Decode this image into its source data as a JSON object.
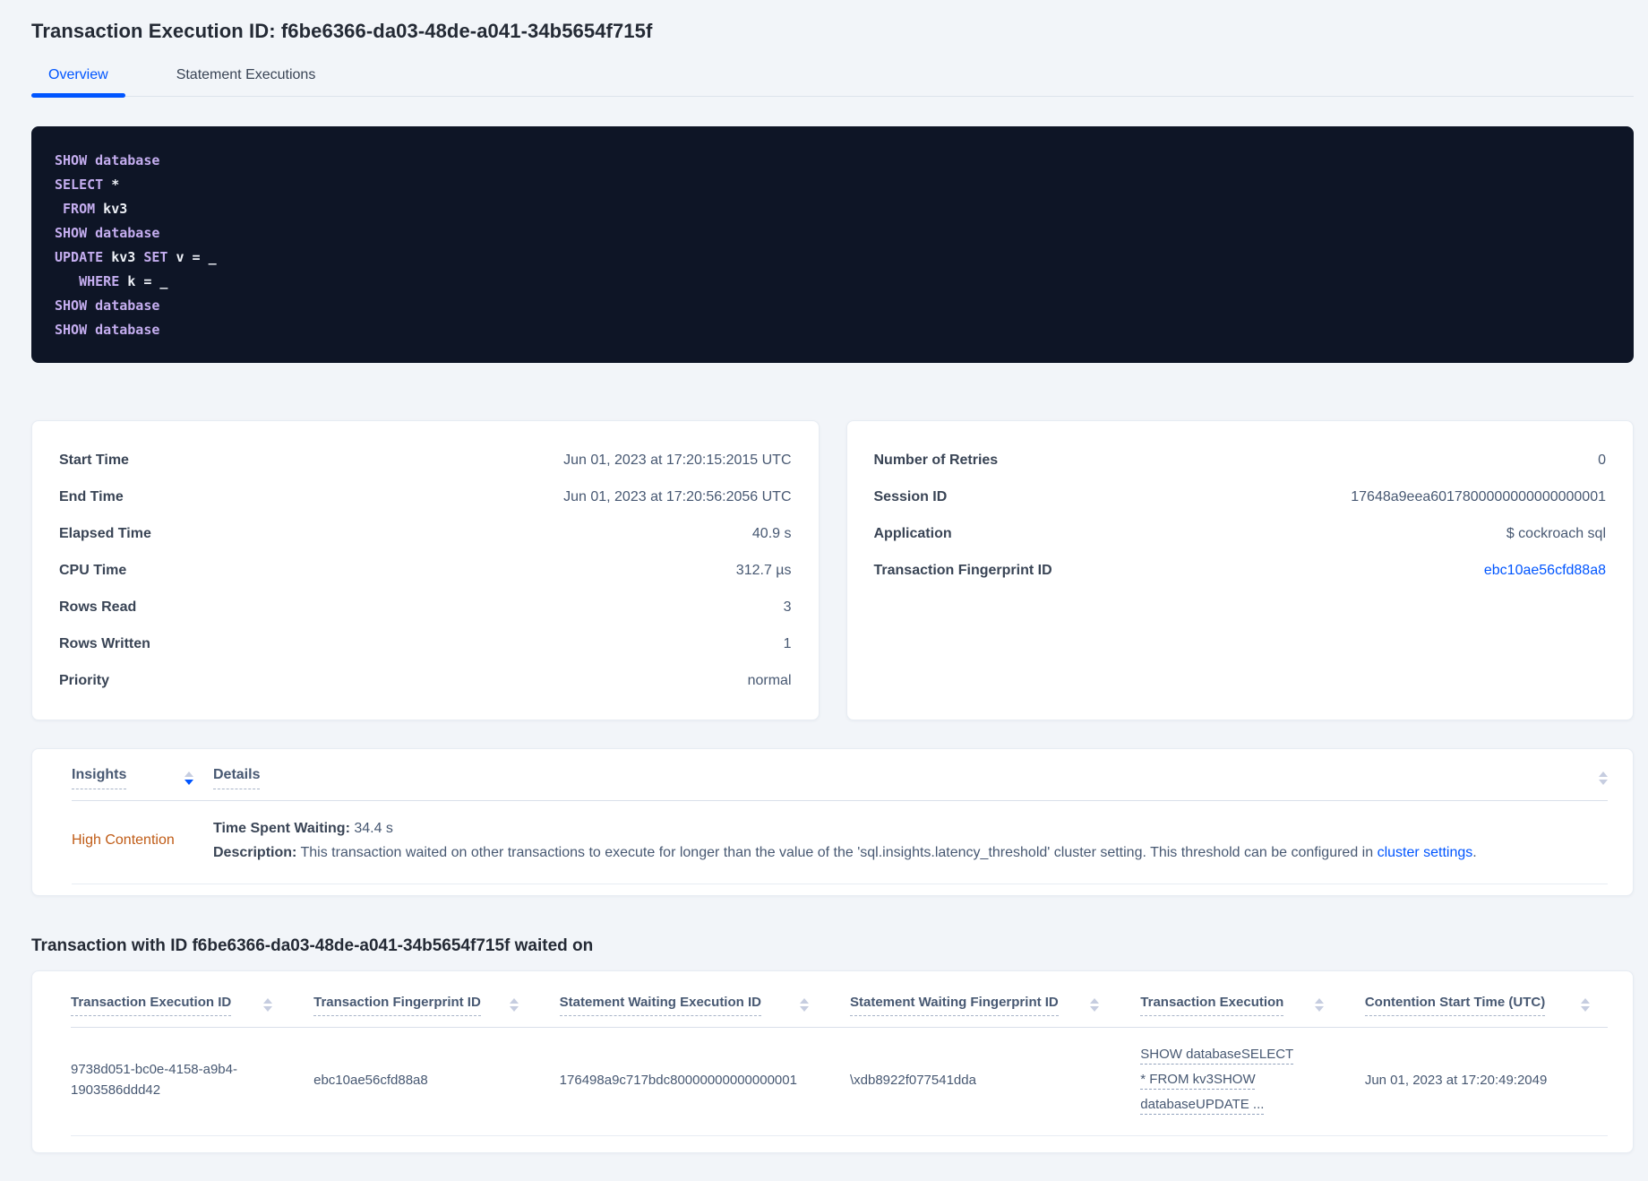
{
  "colors": {
    "accent_blue": "#0055ff",
    "insight_warning_orange": "#c05c17",
    "sql_block_bg": "#0e1526",
    "sql_keyword_purple": "#c5aef0",
    "sql_plain_white": "#eef1f7",
    "page_bg": "#f2f5f9"
  },
  "header": {
    "title": "Transaction Execution ID: f6be6366-da03-48de-a041-34b5654f715f",
    "tabs": {
      "overview": "Overview",
      "statement_executions": "Statement Executions"
    }
  },
  "sql_box": {
    "line1_kw": "SHOW database",
    "line2_kw": "SELECT",
    "line2_pl": " *",
    "line3_kw": " FROM",
    "line3_pl": " kv3",
    "line4_kw": "SHOW database",
    "line5_kw1": "UPDATE",
    "line5_pl1": " kv3 ",
    "line5_kw2": "SET",
    "line5_pl2": " v = _",
    "line6_pl0": "   ",
    "line6_kw": "WHERE",
    "line6_pl": " k = _",
    "line7_kw": "SHOW database",
    "line8_kw": "SHOW database"
  },
  "summary_left": {
    "rows": [
      {
        "label": "Start Time",
        "value": "Jun 01, 2023 at 17:20:15:2015 UTC"
      },
      {
        "label": "End Time",
        "value": "Jun 01, 2023 at 17:20:56:2056 UTC"
      },
      {
        "label": "Elapsed Time",
        "value": "40.9 s"
      },
      {
        "label": "CPU Time",
        "value": "312.7 µs"
      },
      {
        "label": "Rows Read",
        "value": "3"
      },
      {
        "label": "Rows Written",
        "value": "1"
      },
      {
        "label": "Priority",
        "value": "normal"
      }
    ]
  },
  "summary_right": {
    "rows": [
      {
        "label": "Number of Retries",
        "value": "0"
      },
      {
        "label": "Session ID",
        "value": "17648a9eea6017800000000000000001"
      },
      {
        "label": "Application",
        "value": "$ cockroach sql"
      },
      {
        "label": "Transaction Fingerprint ID",
        "value": "ebc10ae56cfd88a8"
      }
    ]
  },
  "insights": {
    "col_insights": "Insights",
    "col_details": "Details",
    "row": {
      "insight": "High Contention",
      "waiting_label": "Time Spent Waiting:",
      "waiting_value": " 34.4 s",
      "description_label": "Description:",
      "description_text": " This transaction waited on other transactions to execute for longer than the value of the 'sql.insights.latency_threshold' cluster setting. This threshold can be configured in ",
      "description_link": "cluster settings",
      "description_end": "."
    }
  },
  "waited": {
    "heading": "Transaction with ID f6be6366-da03-48de-a041-34b5654f715f waited on",
    "headers": [
      "Transaction Execution ID",
      "Transaction Fingerprint ID",
      "Statement Waiting Execution ID",
      "Statement Waiting Fingerprint ID",
      "Transaction Execution",
      "Contention Start Time (UTC)"
    ],
    "row": {
      "transaction_execution_id": "9738d051-bc0e-4158-a9b4-1903586ddd42",
      "transaction_fingerprint_id": "ebc10ae56cfd88a8",
      "statement_waiting_execution_id": "176498a9c717bdc80000000000000001",
      "statement_waiting_fingerprint_id": "\\xdb8922f077541dda",
      "transaction_execution": "SHOW databaseSELECT * FROM kv3SHOW databaseUPDATE ...",
      "contention_start_time": "Jun 01, 2023 at 17:20:49:2049"
    }
  }
}
